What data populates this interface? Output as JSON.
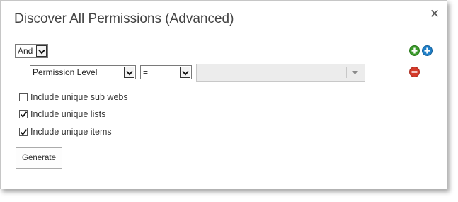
{
  "dialog": {
    "title": "Discover All Permissions (Advanced)",
    "close_glyph": "✕"
  },
  "filter": {
    "logic_value": "And",
    "field_value": "Permission Level",
    "operator_value": "=",
    "value_value": ""
  },
  "icons": {
    "add_group": "plus-circle-green-icon",
    "add_condition": "plus-circle-blue-icon",
    "remove_condition": "minus-circle-red-icon",
    "colors": {
      "green": "#3a9a2a",
      "blue": "#1f7fc8",
      "red": "#d43a2a"
    }
  },
  "options": [
    {
      "label": "Include unique sub webs",
      "checked": false
    },
    {
      "label": "Include unique lists",
      "checked": true
    },
    {
      "label": "Include unique items",
      "checked": true
    }
  ],
  "actions": {
    "generate_label": "Generate"
  }
}
